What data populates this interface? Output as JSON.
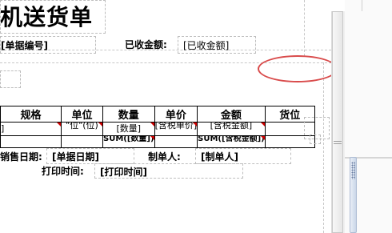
{
  "report": {
    "title": "机送货单",
    "doc_no": "[单据编号]",
    "received_label": "已收金额:",
    "received_value": "[已收金额]",
    "table": {
      "headers": [
        "规格",
        "单位",
        "数量",
        "单价",
        "金额",
        "货位"
      ],
      "row1": [
        "]",
        "\"位\"(位)",
        "[数量]",
        "[含税单价]",
        "[含税金额]",
        ""
      ],
      "row2": [
        "",
        "",
        "SUM([数量])",
        "",
        "SUM([含税金额])",
        ""
      ]
    },
    "sale_date_label": "销售日期:",
    "sale_date_value": "[单据日期]",
    "maker_label": "制单人:",
    "maker_value": "[制单人]",
    "print_time_label": "打印时间:",
    "print_time_value": "[打印时间]"
  },
  "annotation": {
    "color": "#d94b4b"
  }
}
